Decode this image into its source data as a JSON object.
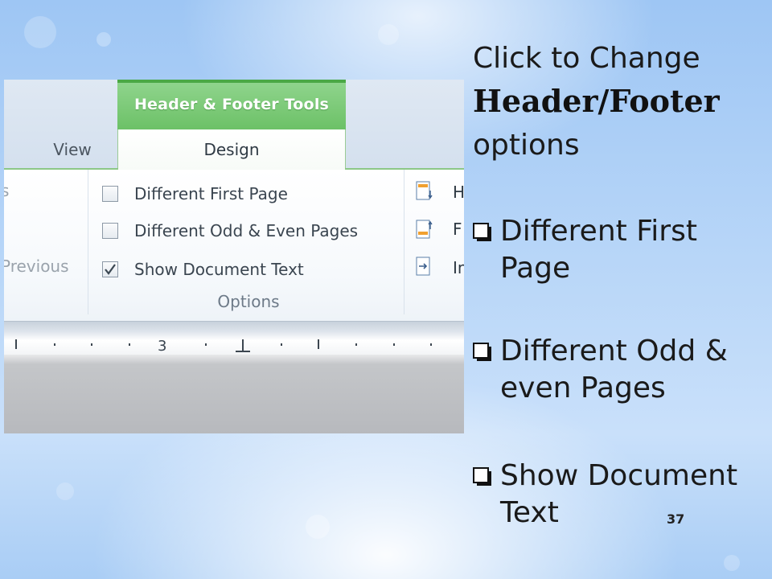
{
  "screenshot": {
    "contextual_tab": "Header & Footer Tools",
    "tabs": [
      "View",
      "Design"
    ],
    "active_tab": "Design",
    "left_group_partial_label": "Previous",
    "options": [
      {
        "label": "Different First Page",
        "checked": false
      },
      {
        "label": "Different Odd & Even Pages",
        "checked": false
      },
      {
        "label": "Show Document Text",
        "checked": true
      }
    ],
    "options_group_label": "Options",
    "position_group_partial": [
      "H",
      "F",
      "In"
    ],
    "ruler_number": "3"
  },
  "slide": {
    "title_line1": "Click to Change",
    "title_line2": "Header/Footer",
    "title_line3": "options",
    "bullets": [
      "Different First Page",
      "Different Odd & even Pages",
      "Show Document Text"
    ],
    "page_number": "37"
  },
  "colors": {
    "contextual_green": "#6cc167",
    "background_blue": "#b8d6f8"
  }
}
